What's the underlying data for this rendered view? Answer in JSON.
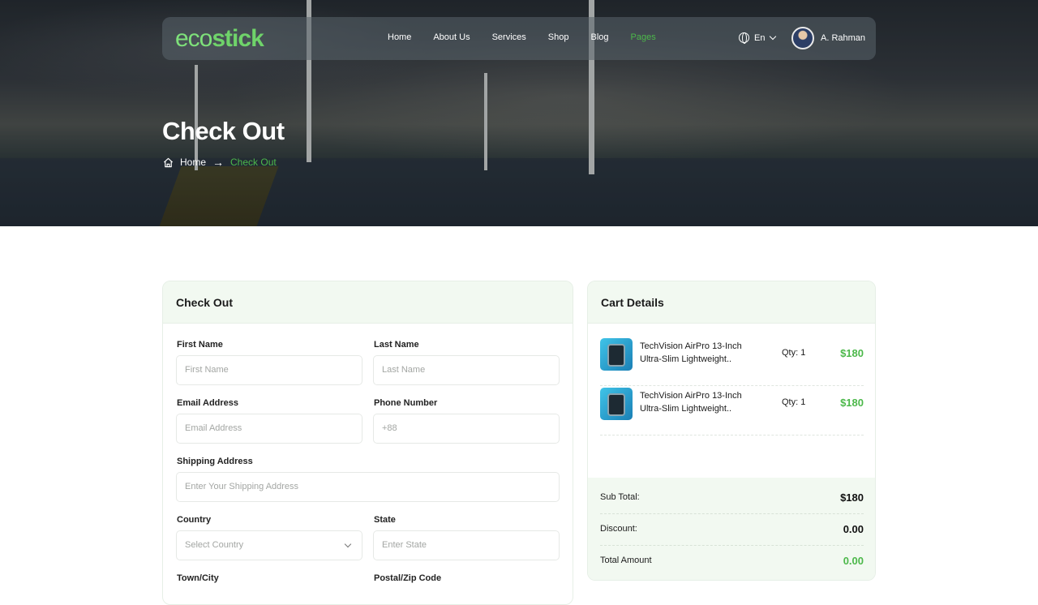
{
  "brand": {
    "logo_part1": "eco",
    "logo_part2": "stick"
  },
  "nav": {
    "items": [
      "Home",
      "About Us",
      "Services",
      "Shop",
      "Blog",
      "Pages"
    ],
    "active": "Pages",
    "language": "En",
    "user_name": "A. Rahman"
  },
  "hero": {
    "title": "Check Out",
    "breadcrumb_home": "Home",
    "breadcrumb_current": "Check Out"
  },
  "checkout": {
    "heading": "Check Out",
    "fields": {
      "first_name": {
        "label": "First Name",
        "placeholder": "First Name"
      },
      "last_name": {
        "label": "Last Name",
        "placeholder": "Last Name"
      },
      "email": {
        "label": "Email Address",
        "placeholder": "Email Address"
      },
      "phone": {
        "label": "Phone Number",
        "placeholder": "+88"
      },
      "shipping": {
        "label": "Shipping Address",
        "placeholder": "Enter Your Shipping Address"
      },
      "country": {
        "label": "Country",
        "placeholder": "Select Country"
      },
      "state": {
        "label": "State",
        "placeholder": "Enter State"
      },
      "town": {
        "label": "Town/City"
      },
      "postal": {
        "label": "Postal/Zip Code"
      }
    }
  },
  "cart": {
    "heading": "Cart Details",
    "items": [
      {
        "name": "TechVision AirPro 13-Inch Ultra-Slim Lightweight..",
        "qty": "Qty: 1",
        "price": "$180"
      },
      {
        "name": "TechVision AirPro 13-Inch Ultra-Slim Lightweight..",
        "qty": "Qty: 1",
        "price": "$180"
      }
    ],
    "summary": {
      "subtotal_label": "Sub Total:",
      "subtotal": "$180",
      "discount_label": "Discount:",
      "discount": "0.00",
      "total_label": "Total Amount",
      "total": "0.00"
    }
  },
  "colors": {
    "accent": "#4cb84a",
    "panel_bg": "#f2f9f1"
  },
  "icons": {
    "language": "globe-icon",
    "breadcrumb_home": "home-icon",
    "breadcrumb_sep": "arrow-right-icon",
    "dropdown": "chevron-down-icon"
  }
}
